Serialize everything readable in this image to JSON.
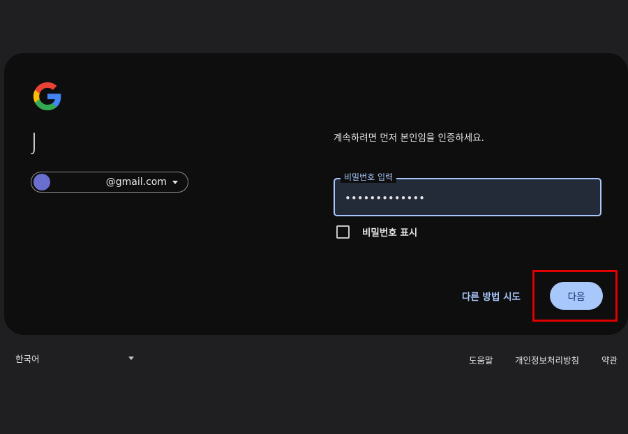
{
  "account": {
    "initial": "J",
    "email": "@gmail.com",
    "avatar_color": "#6a6fcf"
  },
  "verify": {
    "instruction": "계속하려면 먼저 본인임을 인증하세요.",
    "password_label": "비밀번호 입력",
    "password_value": "•••••••••••••",
    "show_password_label": "비밀번호 표시",
    "show_password_checked": false
  },
  "actions": {
    "try_another": "다른 방법 시도",
    "next": "다음"
  },
  "footer": {
    "language": "한국어",
    "help": "도움말",
    "privacy": "개인정보처리방침",
    "terms": "약관"
  },
  "colors": {
    "accent": "#a8c7fa",
    "highlight": "#e00000",
    "card_bg": "#0e0e0f",
    "page_bg": "#1f1f21"
  }
}
